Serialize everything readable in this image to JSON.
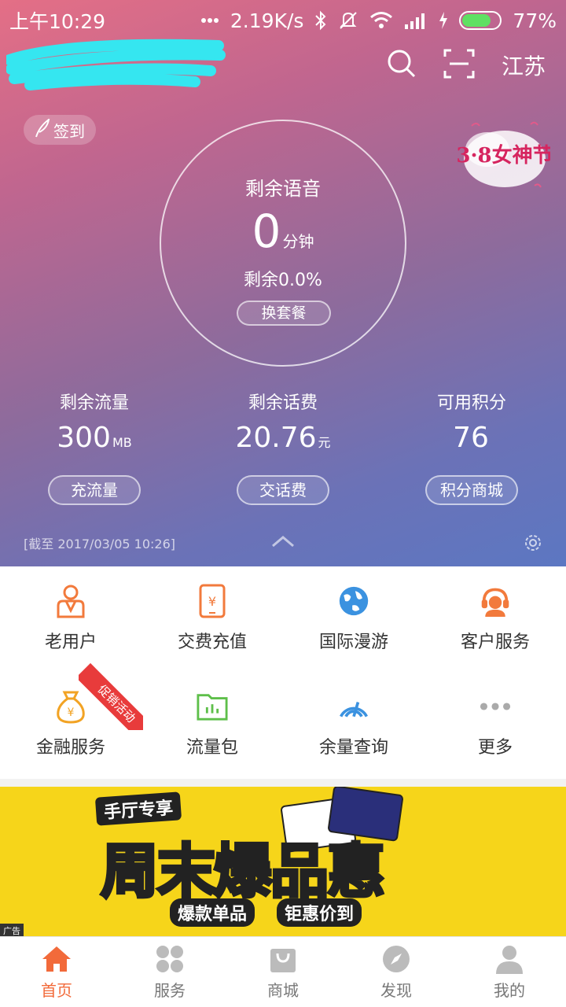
{
  "status": {
    "time": "上午10:29",
    "speed": "2.19K/s",
    "battery": "77%",
    "battery_level": 0.77
  },
  "header": {
    "region": "江苏"
  },
  "signin": {
    "label": "签到"
  },
  "promo_badge": {
    "text": "3·8女神节"
  },
  "voice": {
    "title": "剩余语音",
    "value": "0",
    "unit": "分钟",
    "percent": "剩余0.0%",
    "button": "换套餐"
  },
  "stats": [
    {
      "label": "剩余流量",
      "value": "300",
      "unit": "MB",
      "button": "充流量"
    },
    {
      "label": "剩余话费",
      "value": "20.76",
      "unit": "元",
      "button": "交话费"
    },
    {
      "label": "可用积分",
      "value": "76",
      "unit": "",
      "button": "积分商城"
    }
  ],
  "as_of": "[截至 2017/03/05 10:26]",
  "grid": [
    {
      "label": "老用户",
      "icon": "old-user-icon"
    },
    {
      "label": "交费充值",
      "icon": "recharge-phone-icon"
    },
    {
      "label": "国际漫游",
      "icon": "globe-icon"
    },
    {
      "label": "客户服务",
      "icon": "headset-icon"
    },
    {
      "label": "金融服务",
      "icon": "money-bag-icon"
    },
    {
      "label": "流量包",
      "icon": "data-folder-icon"
    },
    {
      "label": "余量查询",
      "icon": "signal-meter-icon"
    },
    {
      "label": "更多",
      "icon": "more-dots-icon"
    }
  ],
  "promo_ribbon": "促销活动",
  "banner": {
    "small": "手厅专享",
    "main_a": "周末",
    "main_b": "爆品惠",
    "sub1": "爆款单品",
    "sub2": "钜惠价到",
    "ad": "广告"
  },
  "tabs": [
    {
      "label": "首页",
      "icon": "home-icon",
      "active": true
    },
    {
      "label": "服务",
      "icon": "grid-icon",
      "active": false
    },
    {
      "label": "商城",
      "icon": "shopping-bag-icon",
      "active": false
    },
    {
      "label": "发现",
      "icon": "compass-icon",
      "active": false
    },
    {
      "label": "我的",
      "icon": "person-icon",
      "active": false
    }
  ],
  "colors": {
    "accent": "#f26a3a",
    "icon_orange": "#f27a3c",
    "icon_blue": "#3b92e0",
    "icon_green": "#5ebf4a",
    "banner_yellow": "#f6d51a"
  }
}
